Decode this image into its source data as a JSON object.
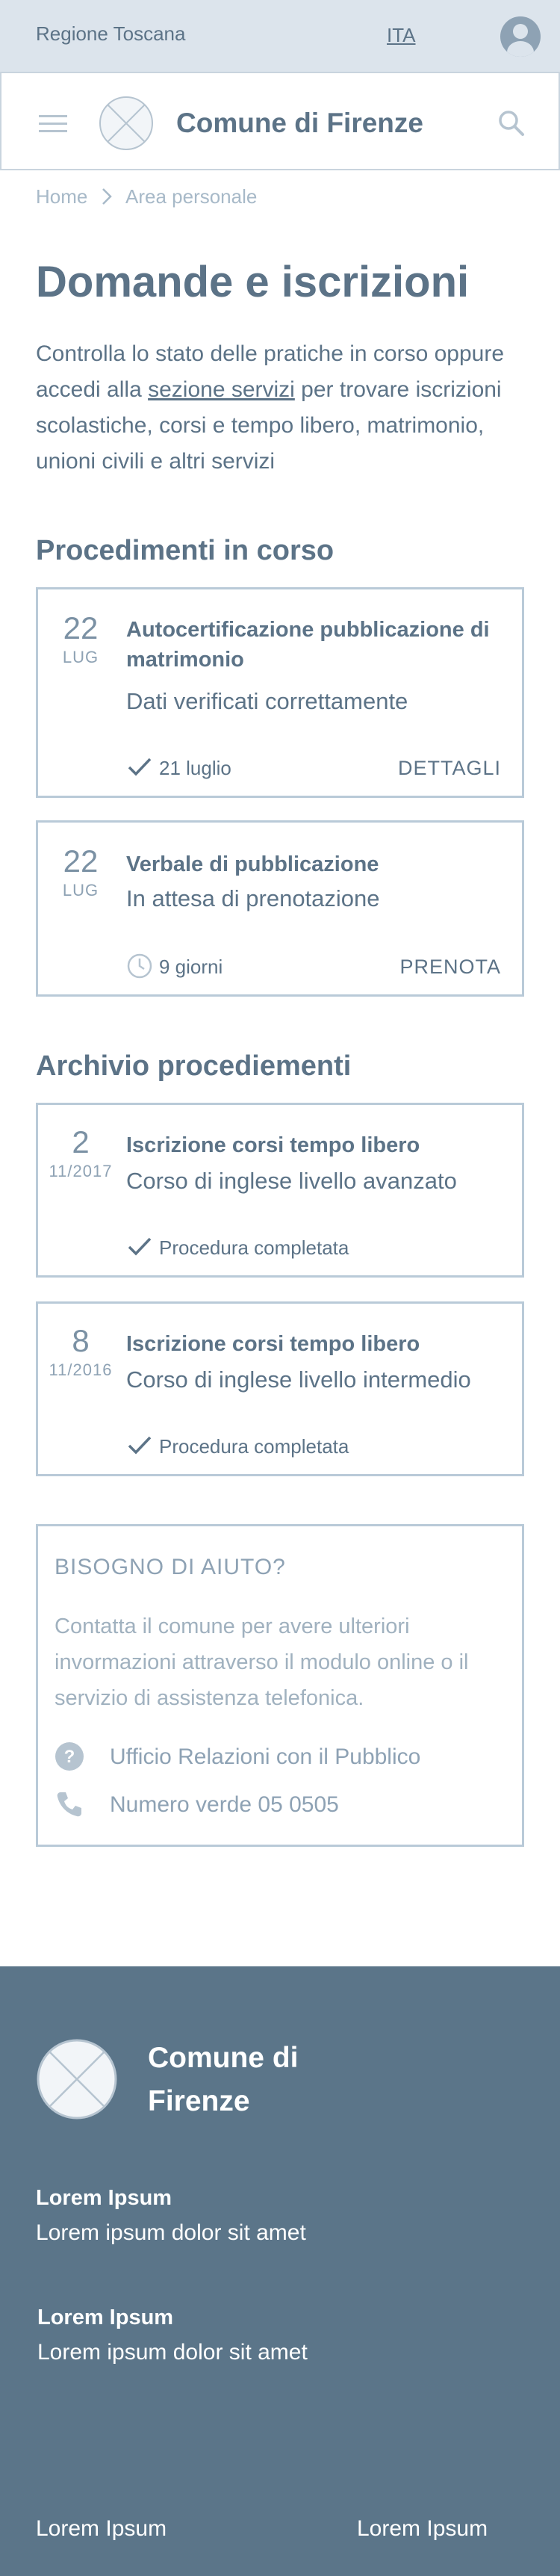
{
  "topbar": {
    "region": "Regione Toscana",
    "language": "ITA",
    "user_icon": "user-avatar-icon"
  },
  "header": {
    "title": "Comune di Firenze",
    "menu_icon": "hamburger-icon",
    "search_icon": "search-icon"
  },
  "breadcrumb": {
    "home": "Home",
    "current": "Area personale"
  },
  "page": {
    "title": "Domande e iscrizioni",
    "intro_before": "Controlla lo stato delle pratiche in corso oppure accedi alla ",
    "intro_link": "sezione servizi",
    "intro_after": " per trovare iscrizioni scolastiche, corsi e tempo libero, matrimonio, unioni civili e altri servizi"
  },
  "in_progress": {
    "title": "Procedimenti in corso",
    "items": [
      {
        "day": "22",
        "month": "LUG",
        "title": "Autocertificazione pubblicazione di matrimonio",
        "subtitle": "Dati verificati correttamente",
        "status": "21 luglio",
        "status_icon": "check-icon",
        "action": "DETTAGLI"
      },
      {
        "day": "22",
        "month": "LUG",
        "title": "Verbale di pubblicazione",
        "subtitle": "In attesa di prenotazione",
        "status": "9 giorni",
        "status_icon": "clock-icon",
        "action": "PRENOTA"
      }
    ]
  },
  "archive": {
    "title": "Archivio procediementi",
    "items": [
      {
        "day": "2",
        "month": "11/2017",
        "title": "Iscrizione corsi tempo libero",
        "subtitle": "Corso di inglese livello avanzato",
        "status": "Procedura completata",
        "status_icon": "check-icon"
      },
      {
        "day": "8",
        "month": "11/2016",
        "title": "Iscrizione corsi tempo libero",
        "subtitle": "Corso di inglese livello intermedio",
        "status": "Procedura completata",
        "status_icon": "check-icon"
      }
    ]
  },
  "help": {
    "title": "BISOGNO DI AIUTO?",
    "text": "Contatta il comune per avere ulteriori invormazioni attraverso il modulo online o il servizio di assistenza telefonica.",
    "office": "Ufficio Relazioni con il Pubblico",
    "phone": "Numero verde 05 0505"
  },
  "footer": {
    "name": "Comune di Firenze",
    "blocks": [
      {
        "heading": "Lorem Ipsum",
        "text": "Lorem ipsum dolor sit amet"
      },
      {
        "heading": "Lorem Ipsum",
        "text": "Lorem ipsum dolor sit amet"
      }
    ],
    "bottom_left": "Lorem Ipsum",
    "bottom_right": "Lorem Ipsum"
  },
  "colors": {
    "primary": "#5c7387",
    "topbar_bg": "#dce4ec",
    "border": "#b9cad8",
    "footer_bg": "#5b7589"
  }
}
